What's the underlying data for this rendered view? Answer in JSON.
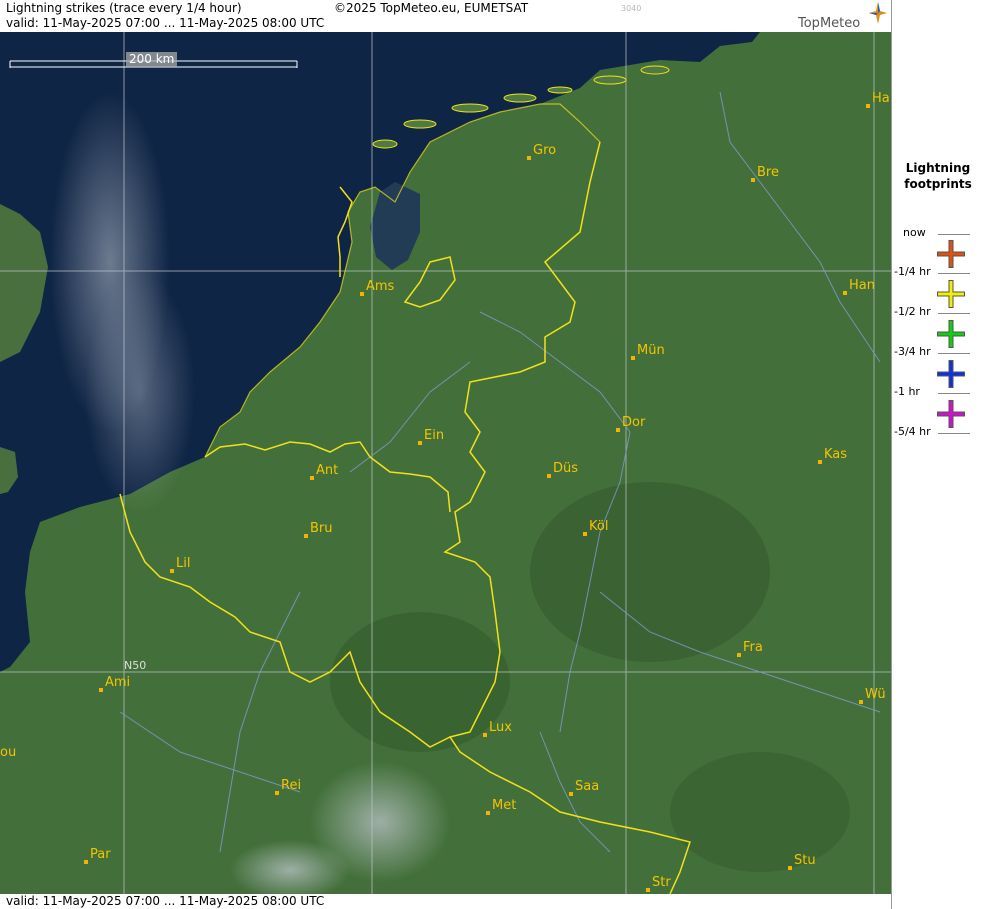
{
  "header": {
    "title": "Lightning strikes (trace every 1/4 hour)",
    "valid": "valid:  11-May-2025 07:00 ... 11-May-2025 08:00 UTC",
    "copyright": "©2025 TopMeteo.eu, EUMETSAT",
    "code": "3040",
    "logo_text": "TopMeteo"
  },
  "map": {
    "scale_label": "200 km",
    "latitude_label": "N50",
    "cities": [
      {
        "name": "Gro"
      },
      {
        "name": "Bre"
      },
      {
        "name": "Ha"
      },
      {
        "name": "Ams"
      },
      {
        "name": "Han"
      },
      {
        "name": "Mün"
      },
      {
        "name": "Ein"
      },
      {
        "name": "Dor"
      },
      {
        "name": "Ant"
      },
      {
        "name": "Düs"
      },
      {
        "name": "Kas"
      },
      {
        "name": "Bru"
      },
      {
        "name": "Köl"
      },
      {
        "name": "Lil"
      },
      {
        "name": "Fra"
      },
      {
        "name": "Ami"
      },
      {
        "name": "Wü"
      },
      {
        "name": "Lux"
      },
      {
        "name": "ou"
      },
      {
        "name": "Rei"
      },
      {
        "name": "Saa"
      },
      {
        "name": "Met"
      },
      {
        "name": "Par"
      },
      {
        "name": "Stu"
      },
      {
        "name": "Str"
      }
    ]
  },
  "legend": {
    "title_line1": "Lightning",
    "title_line2": "footprints",
    "items": [
      {
        "label": "now",
        "color": "#e05010"
      },
      {
        "label": "-1/4 hr",
        "color": "#f0f000"
      },
      {
        "label": "-1/2 hr",
        "color": "#10d010"
      },
      {
        "label": "-3/4 hr",
        "color": "#1030e0"
      },
      {
        "label": "-1 hr",
        "color": "#d010d0"
      },
      {
        "label": "-5/4 hr",
        "color": ""
      }
    ]
  },
  "footer": {
    "valid": "valid:  11-May-2025 07:00 ... 11-May-2025 08:00 UTC"
  }
}
